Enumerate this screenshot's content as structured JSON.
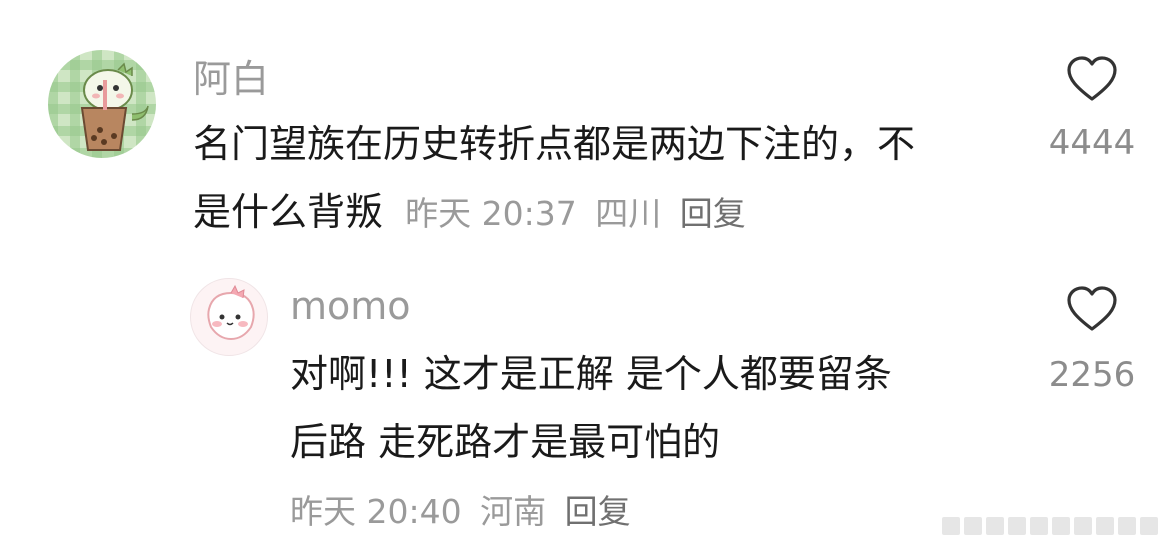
{
  "comments": [
    {
      "username": "阿白",
      "text_line1": "名门望族在历史转折点都是两边下注的，不",
      "text_line2": "是什么背叛",
      "time": "昨天 20:37",
      "location": "四川",
      "reply_label": "回复",
      "likes": "4444"
    },
    {
      "username": "momo",
      "text_line1": "对啊!!! 这才是正解 是个人都要留条",
      "text_line2": "后路 走死路才是最可怕的",
      "time": "昨天 20:40",
      "location": "河南",
      "reply_label": "回复",
      "likes": "2256"
    }
  ],
  "colors": {
    "meta_gray": "#9a9a9a",
    "text_black": "#1a1a1a"
  }
}
